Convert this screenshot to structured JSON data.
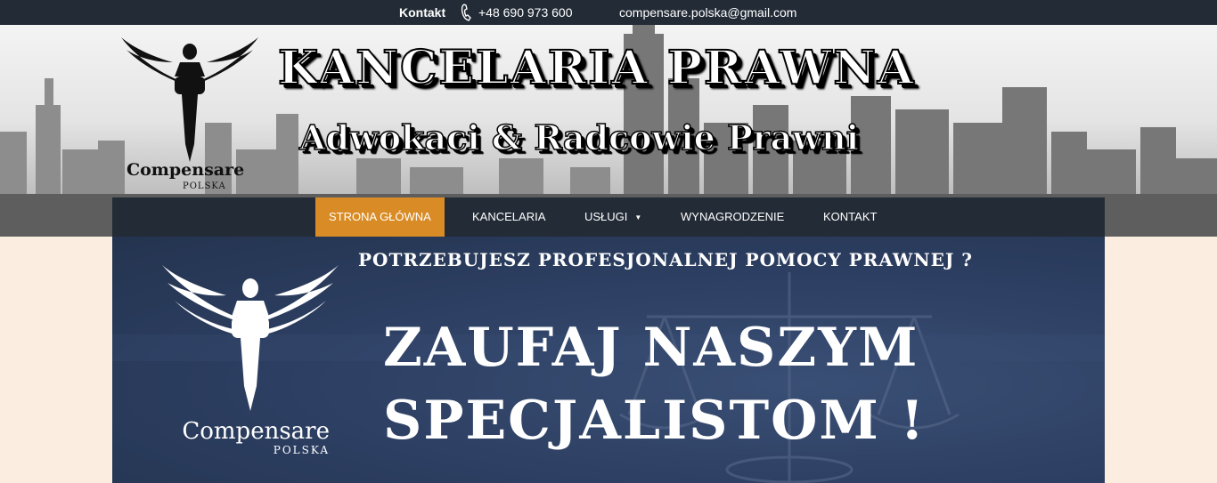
{
  "topbar": {
    "contact_label": "Kontakt",
    "phone": "+48 690 973 600",
    "email": "compensare.polska@gmail.com",
    "icon": "phone-icon"
  },
  "banner": {
    "title": "KANCELARIA  PRAWNA",
    "subtitle": "Adwokaci & Radcowie Prawni",
    "brand_name": "Compensare",
    "brand_sub": "POLSKA"
  },
  "nav": {
    "items": [
      {
        "label": "STRONA GŁÓWNA",
        "active": true
      },
      {
        "label": "KANCELARIA"
      },
      {
        "label": "USŁUGI",
        "dropdown": true
      },
      {
        "label": "WYNAGRODZENIE"
      },
      {
        "label": "KONTAKT"
      }
    ],
    "active_color": "#d98b25",
    "bg_color": "#232b36"
  },
  "hero": {
    "question": "POTRZEBUJESZ PROFESJONALNEJ POMOCY PRAWNEJ ?",
    "line1": "ZAUFAJ NASZYM",
    "line2": "SPECJALISTOM !",
    "brand_name": "Compensare",
    "brand_sub": "POLSKA",
    "bg_color": "#2c3e61"
  },
  "page_bg": "#fbeee0"
}
